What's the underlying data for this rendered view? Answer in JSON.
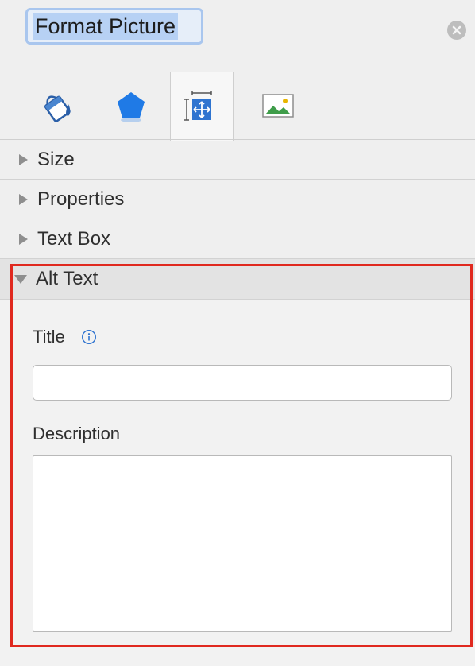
{
  "header": {
    "title": "Format Picture",
    "close_icon": "close-circle-icon"
  },
  "tabs": [
    {
      "icon": "paint-bucket-icon",
      "name": "Fill & Line",
      "selected": false
    },
    {
      "icon": "pentagon-effects-icon",
      "name": "Effects",
      "selected": false
    },
    {
      "icon": "size-properties-icon",
      "name": "Size & Properties",
      "selected": true
    },
    {
      "icon": "picture-icon",
      "name": "Picture",
      "selected": false
    }
  ],
  "sections": [
    {
      "label": "Size",
      "expanded": false
    },
    {
      "label": "Properties",
      "expanded": false
    },
    {
      "label": "Text Box",
      "expanded": false
    },
    {
      "label": "Alt Text",
      "expanded": true
    }
  ],
  "alt_text": {
    "title_label": "Title",
    "title_value": "",
    "description_label": "Description",
    "description_value": ""
  },
  "colors": {
    "highlight": "#e0291f",
    "accent": "#2f74d0"
  }
}
